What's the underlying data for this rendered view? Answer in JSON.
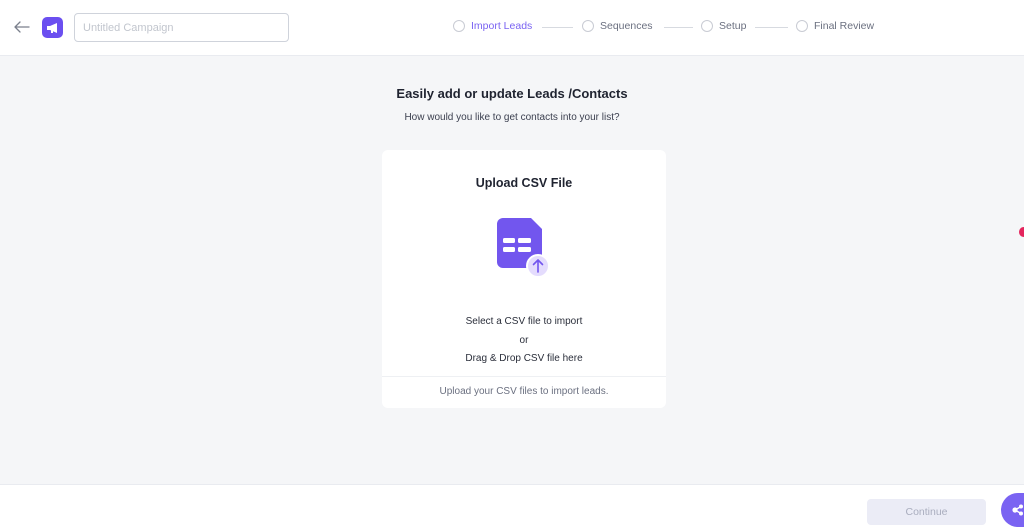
{
  "header": {
    "back_icon": "arrow-left-icon",
    "logo_icon": "megaphone-icon",
    "campaign_name": {
      "value": "",
      "placeholder": "Untitled Campaign"
    }
  },
  "stepper": {
    "steps": [
      {
        "label": "Import Leads",
        "active": true
      },
      {
        "label": "Sequences",
        "active": false
      },
      {
        "label": "Setup",
        "active": false
      },
      {
        "label": "Final Review",
        "active": false
      }
    ]
  },
  "main": {
    "heading": "Easily add or update Leads /Contacts",
    "subheading": "How would you like to get contacts into your list?",
    "upload_card": {
      "title": "Upload CSV File",
      "icon": "csv-file-upload-icon",
      "line1": "Select a CSV file to import",
      "line2": "or",
      "line3": "Drag & Drop CSV file here",
      "footer": "Upload your CSV files to import leads."
    }
  },
  "footer": {
    "continue_label": "Continue",
    "chat_icon": "chat-support-icon"
  },
  "colors": {
    "accent": "#7a63f2",
    "brand": "#6b4ff0",
    "background": "#f5f6f8",
    "notification_dot": "#e4255d"
  }
}
